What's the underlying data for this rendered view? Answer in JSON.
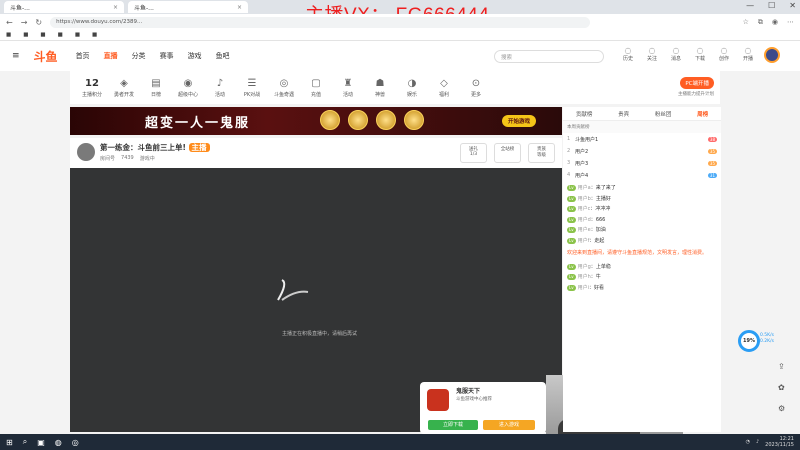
{
  "browser": {
    "tabs": [
      {
        "label": "斗鱼-..."
      },
      {
        "label": "斗鱼-..."
      }
    ],
    "url": "https://www.douyu.com/2389...",
    "watermark": "主播VX：  FG666444"
  },
  "site": {
    "logo": "斗鱼",
    "nav": [
      "首页",
      "直播",
      "分类",
      "赛事",
      "游戏",
      "鱼吧"
    ],
    "active_nav": "直播",
    "search_placeholder": "搜索",
    "header_icons": [
      "历史",
      "关注",
      "消息",
      "下载",
      "创作",
      "开播",
      "客服"
    ]
  },
  "toolbar": {
    "first_value": "12",
    "first_label": "主播积分",
    "tools": [
      "勇者开发",
      "日榜",
      "超级中心",
      "活动",
      "PK对战",
      "斗鱼奇遇",
      "充值",
      "活动",
      "神兽",
      "娱乐",
      "福利",
      "更多"
    ],
    "pc_button": "PC端开播",
    "pc_sub": "主播能力提升计划"
  },
  "banner": {
    "title": "超变一人一鬼服",
    "button": "开始游戏"
  },
  "room": {
    "title": "第一练金：斗鱼前三上单!",
    "tag": "主播",
    "sub": [
      "房间号",
      "7439",
      "游戏中"
    ],
    "boxes": [
      {
        "label": "送礼",
        "value": "1/3"
      },
      {
        "label": "全站榜"
      },
      {
        "label": "贵族",
        "value": "等级"
      }
    ]
  },
  "player": {
    "message": "主播正在积极直播中，请稍后再试"
  },
  "popup": {
    "title": "鬼服天下",
    "subtitle": "斗鱼游戏中心推荐",
    "btn_primary": "立即下载",
    "btn_secondary": "进入游戏"
  },
  "sidebar": {
    "tabs": [
      "贡献榜",
      "贵宾",
      "粉丝团",
      "周榜"
    ],
    "active_tab": "周榜",
    "rank_header": "本周贡献榜",
    "ranks": [
      {
        "n": "1",
        "name": "斗鱼用户1",
        "pill": "38"
      },
      {
        "n": "2",
        "name": "用户2",
        "pill": "35"
      },
      {
        "n": "3",
        "name": "用户3",
        "pill": "35"
      },
      {
        "n": "4",
        "name": "用户4",
        "pill": "31"
      }
    ],
    "chats": [
      {
        "lv": "Lv",
        "user": "用户a",
        "text": "来了来了"
      },
      {
        "lv": "Lv",
        "user": "用户b",
        "text": "主播好"
      },
      {
        "lv": "Lv",
        "user": "用户c",
        "text": "冲冲冲"
      },
      {
        "lv": "Lv",
        "user": "用户d",
        "text": "666"
      },
      {
        "lv": "Lv",
        "user": "用户e",
        "text": "加油"
      },
      {
        "lv": "Lv",
        "user": "用户f",
        "text": "走起"
      }
    ],
    "notice": "欢迎来到直播间，请遵守斗鱼直播规范，文明发言，理性消费。",
    "footer_chats": [
      {
        "lv": "Lv",
        "user": "用户g",
        "text": "上单稳"
      },
      {
        "lv": "Lv",
        "user": "用户h",
        "text": "牛"
      },
      {
        "lv": "Lv",
        "user": "用户i",
        "text": "好看"
      }
    ]
  },
  "rail": {
    "donut": "19%",
    "speeds": [
      "0.5K/s",
      "0.2K/s"
    ]
  },
  "taskbar": {
    "time": "12:21",
    "date": "2023/11/15"
  }
}
